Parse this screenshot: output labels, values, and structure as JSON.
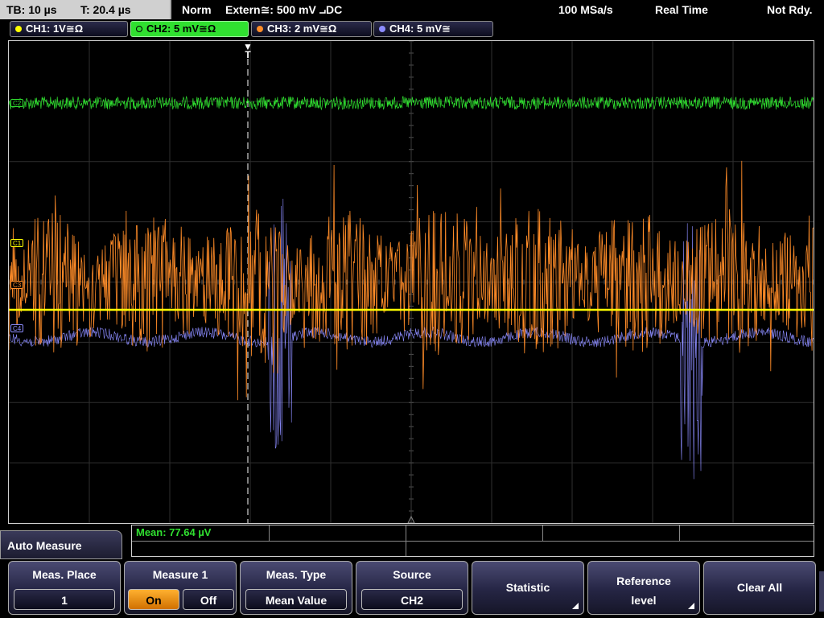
{
  "status_bar": {
    "timebase": "TB: 10 µs",
    "trigger_time": "T: 20.4 µs",
    "trigger_mode": "Norm",
    "trigger_source": "Extern≅: 500 mV ⨼DC",
    "sample_rate": "100 MSa/s",
    "acq_mode": "Real Time",
    "state": "Not Rdy."
  },
  "channels": [
    {
      "label": "CH1: 1V≅Ω",
      "color": "#ffff00",
      "marker": "C1",
      "active": false
    },
    {
      "label": "CH2: 5 mV≅Ω",
      "color": "#30e030",
      "marker": "C2",
      "active": true
    },
    {
      "label": "CH3: 2 mV≅Ω",
      "color": "#ff8c28",
      "marker": "C3",
      "active": false
    },
    {
      "label": "CH4: 5 mV≅",
      "color": "#8c8cff",
      "marker": "C4",
      "active": false
    }
  ],
  "trigger_marker": "T",
  "measurement": {
    "readout": "Mean: 77.64 µV"
  },
  "menu": {
    "title": "Auto Measure",
    "softkeys": [
      {
        "label": "Meas. Place",
        "value": "1"
      },
      {
        "label": "Measure 1",
        "on": "On",
        "off": "Off"
      },
      {
        "label": "Meas. Type",
        "value": "Mean Value"
      },
      {
        "label": "Source",
        "value": "CH2"
      },
      {
        "label": "Statistic"
      },
      {
        "label1": "Reference",
        "label2": "level"
      },
      {
        "label": "Clear All"
      }
    ]
  }
}
